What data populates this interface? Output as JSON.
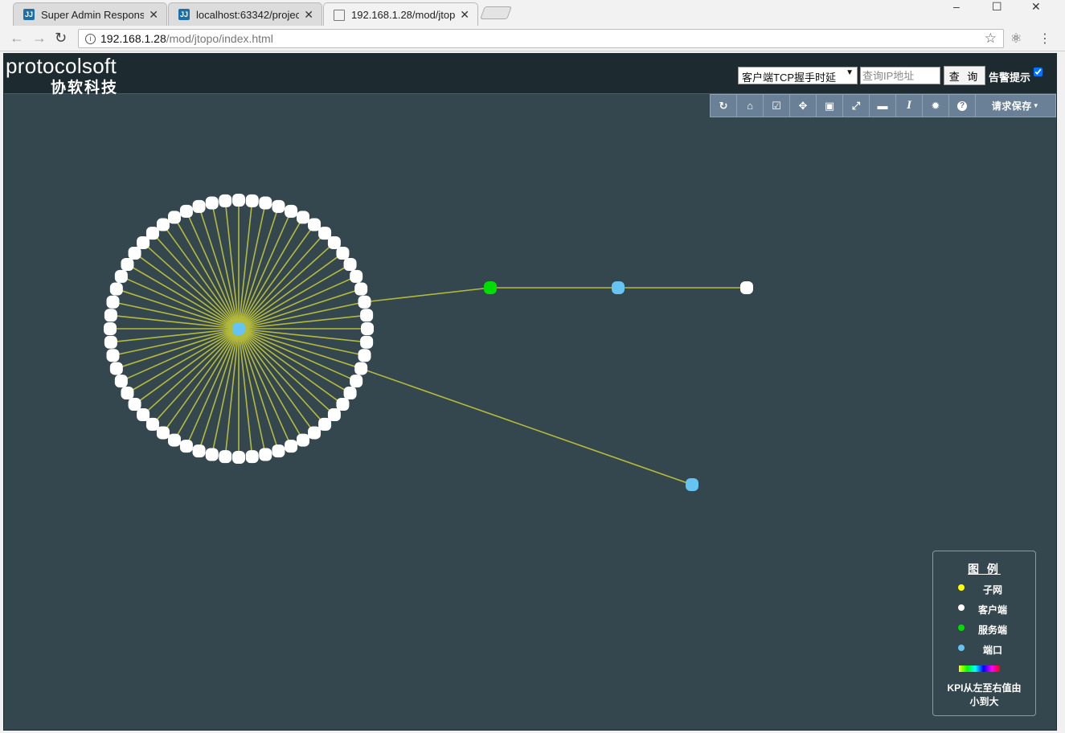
{
  "browser": {
    "tabs": [
      {
        "title": "Super Admin Responsi",
        "favicon": "jetbrains-icon",
        "active": false
      },
      {
        "title": "localhost:63342/projec",
        "favicon": "jetbrains-icon",
        "active": false
      },
      {
        "title": "192.168.1.28/mod/jtop",
        "favicon": "document-icon",
        "active": true
      }
    ],
    "url_host": "192.168.1.28",
    "url_path": "/mod/jtopo/index.html"
  },
  "header": {
    "logo_text": "protocolsoft",
    "logo_cn": "协软科技",
    "metric_select": "客户端TCP握手时延",
    "ip_placeholder": "查询IP地址",
    "query_button": "查 询",
    "alarm_label": "告警提示",
    "alarm_checked": true
  },
  "toolbar": {
    "buttons": [
      {
        "name": "refresh-button",
        "icon": "↻"
      },
      {
        "name": "home-button",
        "icon": "⌂"
      },
      {
        "name": "check-button",
        "icon": "☑"
      },
      {
        "name": "move-button",
        "icon": "✥"
      },
      {
        "name": "image-button",
        "icon": "▣"
      },
      {
        "name": "fullscreen-button",
        "icon": "⤢"
      },
      {
        "name": "comment-button",
        "icon": "▬"
      },
      {
        "name": "italic-button",
        "icon": "I"
      },
      {
        "name": "settings-button",
        "icon": "✹"
      },
      {
        "name": "help-button",
        "icon": "?"
      }
    ],
    "save_label": "请求保存"
  },
  "topology": {
    "colors": {
      "subnet": "#ffff00",
      "client": "#ffffff",
      "server": "#00dd00",
      "port": "#66c4f2",
      "link": "#b5ba3a"
    },
    "ring_client_count": 60,
    "extra_nodes": [
      "server",
      "port",
      "client",
      "port"
    ]
  },
  "legend": {
    "title": "图 例",
    "items": [
      {
        "label": "子网",
        "color": "#ffff00"
      },
      {
        "label": "客户端",
        "color": "#ffffff"
      },
      {
        "label": "服务端",
        "color": "#00dd00"
      },
      {
        "label": "端口",
        "color": "#66c4f2"
      }
    ],
    "kpi_text_line1": "KPI从左至右值由",
    "kpi_text_line2": "小到大"
  }
}
